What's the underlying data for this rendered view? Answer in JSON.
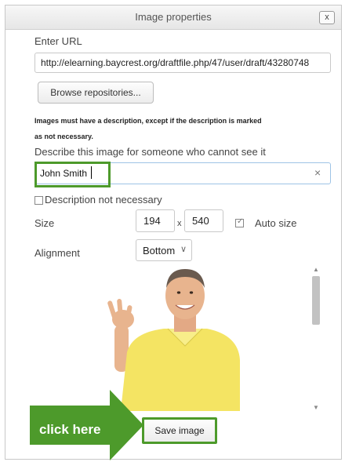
{
  "dialog": {
    "title": "Image properties",
    "close_label": "x"
  },
  "url": {
    "label": "Enter URL",
    "value": "http://elearning.baycrest.org/draftfile.php/47/user/draft/43280748"
  },
  "browse_label": "Browse repositories...",
  "warning": {
    "line1": "Images must have a description, except if the description is marked",
    "line2": "as not necessary."
  },
  "description": {
    "label": "Describe this image for someone who cannot see it",
    "value": "John Smith",
    "clear_label": "×",
    "not_necessary_label": "Description not necessary",
    "not_necessary_checked": false
  },
  "size": {
    "label": "Size",
    "width": "194",
    "separator": "x",
    "height": "540",
    "auto_size_label": "Auto size",
    "auto_size_checked": true
  },
  "alignment": {
    "label": "Alignment",
    "selected": "Bottom"
  },
  "callout": {
    "label": "click here",
    "color": "#4d9a2b"
  },
  "save_label": "Save image",
  "icons": {
    "close": "close-icon",
    "clear": "clear-icon",
    "dropdown": "chevron-down-icon"
  }
}
